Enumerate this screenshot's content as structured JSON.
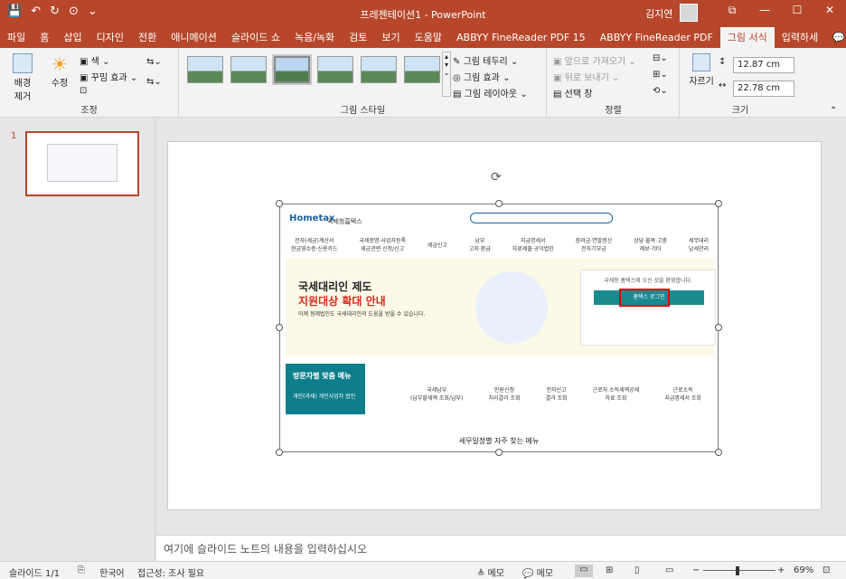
{
  "titlebar": {
    "title": "프레젠테이션1 - PowerPoint",
    "user": "김지연",
    "qat": [
      "💾",
      "↶",
      "↻",
      "⊙",
      "⌄"
    ],
    "window_buttons": [
      "⧉",
      "—",
      "☐",
      "✕"
    ]
  },
  "tabs": [
    "파일",
    "홈",
    "삽입",
    "디자인",
    "전환",
    "애니메이션",
    "슬라이드 쇼",
    "녹음/녹화",
    "검토",
    "보기",
    "도움말",
    "ABBYY FineReader PDF 15",
    "ABBYY FineReader PDF",
    "그림 서식",
    "입력하세",
    "💬"
  ],
  "active_tab_index": 13,
  "ribbon": {
    "adjust": {
      "bg_remove": "배경\n제거",
      "correct": "수정",
      "color": "색",
      "art_effects": "꾸밈 효과",
      "label": "조정"
    },
    "styles": {
      "border": "그림 테두리",
      "effects": "그림 효과",
      "layout": "그림 레이아웃",
      "label": "그림 스타일"
    },
    "arrange": {
      "bring_forward": "앞으로 가져오기",
      "send_backward": "뒤로 보내기",
      "selection_pane": "선택 창",
      "label": "정렬"
    },
    "size": {
      "crop": "자르기",
      "height": "12.87 cm",
      "width": "22.78 cm",
      "label": "크기"
    }
  },
  "slides_pane": {
    "slide_number": "1"
  },
  "slide_image": {
    "logo": "Hometax",
    "logo_sub": "국세청홈택스",
    "nav": [
      "전자(세금)계산서\n현금영수증·신용카드",
      "국세증명·사업자등록\n세금관련 신청/신고",
      "세금신고",
      "납부\n고지·환급",
      "지급명세서\n자료제출·공익법인",
      "장려금·연말정산\n전자기부금",
      "상담·불복·고충\n제보·기타",
      "세무대리\n납세관리"
    ],
    "banner_title": "국세대리인 제도",
    "banner_title2": "지원대상 확대 안내",
    "banner_sub": "이제 형제법인도 국세대리인의 도움을 받을 수 있습니다.",
    "login_msg": "국세청 홈택스에 오신 것을 환영합니다.",
    "login_btn": "홈택스 로그인",
    "visitor_title": "방문자별 맞춤 메뉴",
    "visitor_tabs": "개인(과세) 개인사업자 법인",
    "vitems": [
      "국세납부\n(납부할세액 조회/납부)",
      "민원신청\n처리결과 조회",
      "전자신고\n결과 조회",
      "근로자 소득세액공제\n자료 조회",
      "근로소득\n지급명세서 조회"
    ],
    "faq": "세무일정별 자주 찾는 메뉴"
  },
  "notes": "여기에 슬라이드 노트의 내용을 입력하십시오",
  "status": {
    "slide": "슬라이드 1/1",
    "language": "한국어",
    "accessibility": "접근성: 조사 필요",
    "notes": "≜ 메모",
    "comments": "💬 메모",
    "zoom": "69%"
  }
}
